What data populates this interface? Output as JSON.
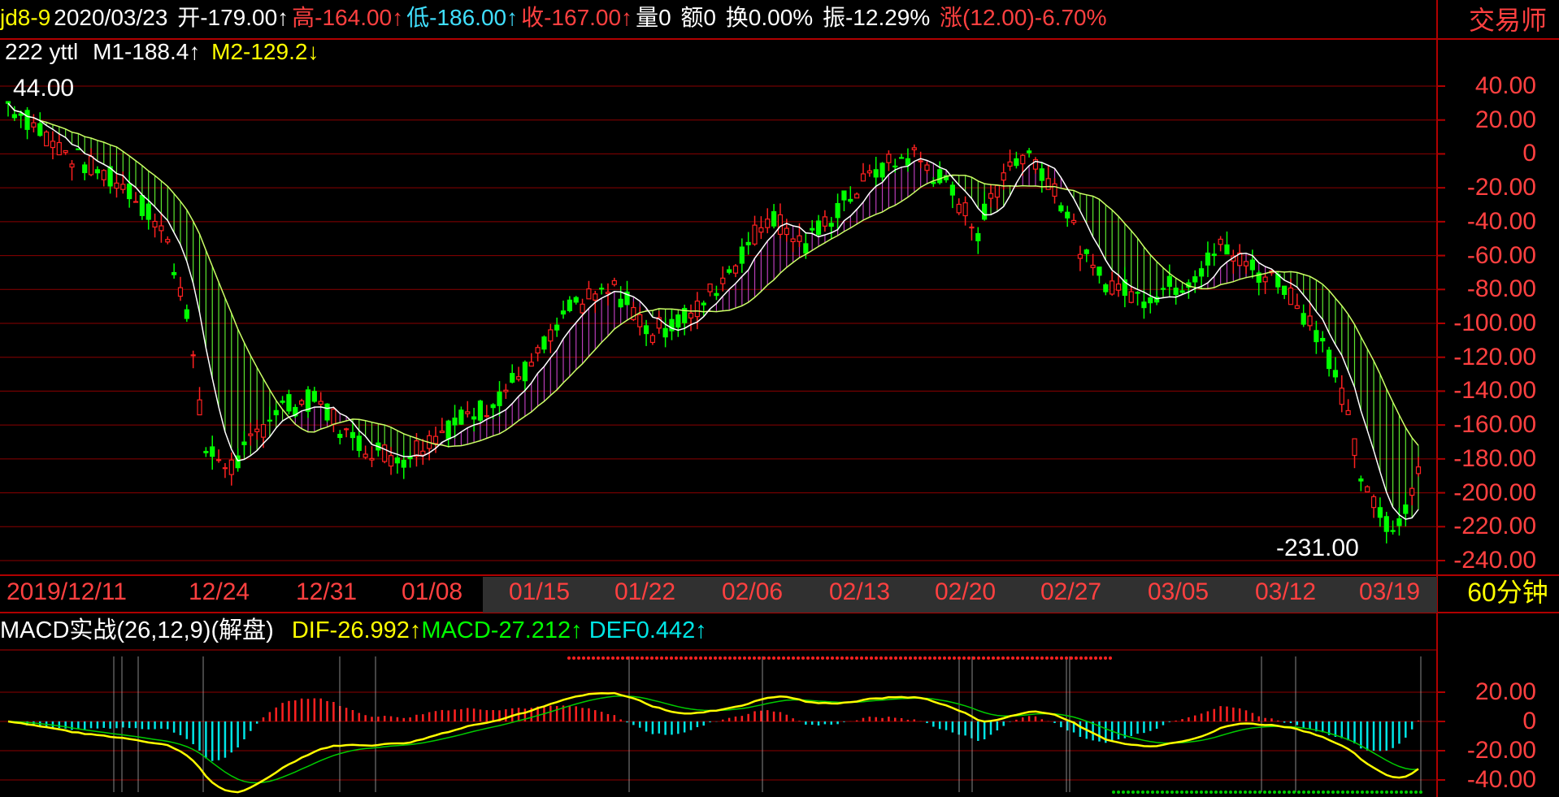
{
  "header": {
    "symbol": "jd8-9",
    "date": "2020/03/23",
    "open": "开-179.00↑",
    "high": "高-164.00↑",
    "low": "低-186.00↑",
    "close": "收-167.00↑",
    "volume": "量0",
    "amount": "额0",
    "turnover": "换0.00%",
    "amplitude": "振-12.29%",
    "change": "涨(12.00)-6.70%"
  },
  "brand": "交易师",
  "indicator_line": {
    "count": "222",
    "name": "yttl",
    "m1": "M1-188.4↑",
    "m2": "M2-129.2↓"
  },
  "price_markers": {
    "high": "44.00",
    "low": "-231.00"
  },
  "price_axis": [
    "40.00",
    "20.00",
    "0",
    "-20.00",
    "-40.00",
    "-60.00",
    "-80.00",
    "-100.00",
    "-120.00",
    "-140.00",
    "-160.00",
    "-180.00",
    "-200.00",
    "-220.00",
    "-240.00"
  ],
  "date_axis": [
    "2019/12/11",
    "12/24",
    "12/31",
    "01/08",
    "01/15",
    "01/22",
    "02/06",
    "02/13",
    "02/20",
    "02/27",
    "03/05",
    "03/12",
    "03/19"
  ],
  "period": {
    "num": "60",
    "unit": "分钟"
  },
  "macd": {
    "title": "MACD实战(26,12,9)(解盘)",
    "dif": "DIF-26.992↑",
    "macd": "MACD-27.212↑",
    "def": "DEF0.442↑",
    "axis": [
      "20.00",
      "0",
      "-20.00",
      "-40.00"
    ]
  },
  "colors": {
    "up": "#ff2020",
    "down": "#00ff00",
    "grid": "#8b0000",
    "axis_text": "#ff4040",
    "ma1": "#ffffff",
    "ma2": "#ffff00",
    "fill_down": "#66ff33",
    "fill_up": "#cc44cc",
    "dif": "#ffff00",
    "dea": "#00cc00",
    "hist_pos": "#ff2020",
    "hist_neg": "#00e5e5"
  }
}
